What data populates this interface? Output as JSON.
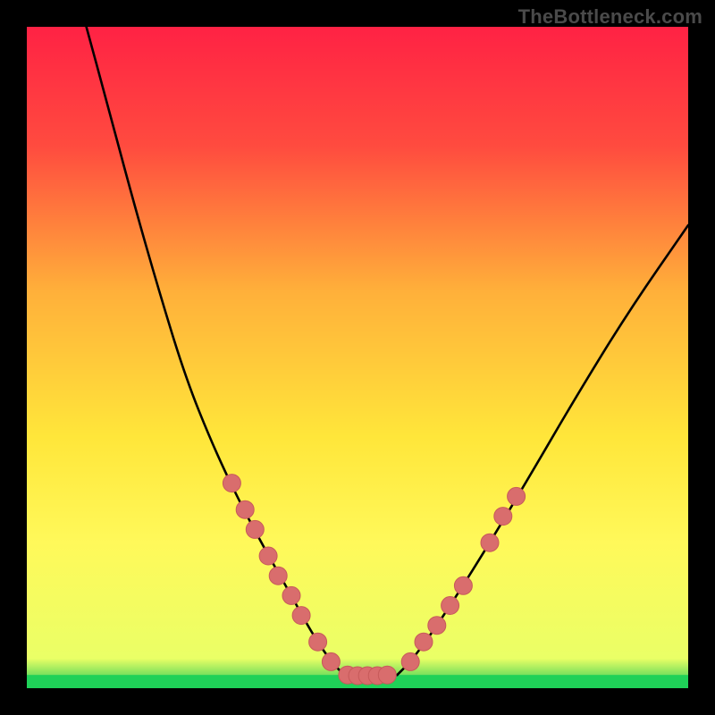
{
  "watermark": "TheBottleneck.com",
  "chart_data": {
    "type": "line",
    "title": "",
    "xlabel": "",
    "ylabel": "",
    "xlim": [
      0,
      100
    ],
    "ylim": [
      0,
      100
    ],
    "gradient_stops": [
      {
        "offset": 0,
        "color": "#ff2244"
      },
      {
        "offset": 0.18,
        "color": "#ff4b3f"
      },
      {
        "offset": 0.4,
        "color": "#ffb03a"
      },
      {
        "offset": 0.62,
        "color": "#ffe63a"
      },
      {
        "offset": 0.78,
        "color": "#fff95a"
      },
      {
        "offset": 0.955,
        "color": "#eaff66"
      },
      {
        "offset": 0.975,
        "color": "#8fe65e"
      },
      {
        "offset": 1.0,
        "color": "#1fd158"
      }
    ],
    "base_strip_y": 98,
    "series": [
      {
        "name": "left-branch",
        "curve": [
          {
            "x": 9.0,
            "y": 100.0
          },
          {
            "x": 12.0,
            "y": 89.0
          },
          {
            "x": 16.0,
            "y": 74.0
          },
          {
            "x": 20.0,
            "y": 60.0
          },
          {
            "x": 24.0,
            "y": 47.0
          },
          {
            "x": 28.0,
            "y": 37.0
          },
          {
            "x": 32.0,
            "y": 28.5
          },
          {
            "x": 36.0,
            "y": 21.0
          },
          {
            "x": 40.0,
            "y": 14.0
          },
          {
            "x": 43.0,
            "y": 8.5
          },
          {
            "x": 46.0,
            "y": 4.0
          },
          {
            "x": 48.0,
            "y": 2.0
          }
        ],
        "markers": [
          {
            "x": 31.0,
            "y": 31.0
          },
          {
            "x": 33.0,
            "y": 27.0
          },
          {
            "x": 34.5,
            "y": 24.0
          },
          {
            "x": 36.5,
            "y": 20.0
          },
          {
            "x": 38.0,
            "y": 17.0
          },
          {
            "x": 40.0,
            "y": 14.0
          },
          {
            "x": 41.5,
            "y": 11.0
          },
          {
            "x": 44.0,
            "y": 7.0
          },
          {
            "x": 46.0,
            "y": 4.0
          }
        ]
      },
      {
        "name": "right-branch",
        "curve": [
          {
            "x": 56.0,
            "y": 2.0
          },
          {
            "x": 58.0,
            "y": 4.0
          },
          {
            "x": 61.0,
            "y": 8.0
          },
          {
            "x": 65.0,
            "y": 14.0
          },
          {
            "x": 70.0,
            "y": 22.0
          },
          {
            "x": 76.0,
            "y": 32.0
          },
          {
            "x": 83.0,
            "y": 44.0
          },
          {
            "x": 91.0,
            "y": 57.0
          },
          {
            "x": 100.0,
            "y": 70.0
          }
        ],
        "markers": [
          {
            "x": 58.0,
            "y": 4.0
          },
          {
            "x": 60.0,
            "y": 7.0
          },
          {
            "x": 62.0,
            "y": 9.5
          },
          {
            "x": 64.0,
            "y": 12.5
          },
          {
            "x": 66.0,
            "y": 15.5
          },
          {
            "x": 70.0,
            "y": 22.0
          },
          {
            "x": 72.0,
            "y": 26.0
          },
          {
            "x": 74.0,
            "y": 29.0
          }
        ]
      },
      {
        "name": "trough",
        "curve": [
          {
            "x": 48.0,
            "y": 2.0
          },
          {
            "x": 50.0,
            "y": 1.8
          },
          {
            "x": 52.0,
            "y": 1.8
          },
          {
            "x": 54.0,
            "y": 1.9
          },
          {
            "x": 56.0,
            "y": 2.0
          }
        ],
        "markers": [
          {
            "x": 48.5,
            "y": 2.0
          },
          {
            "x": 50.0,
            "y": 1.9
          },
          {
            "x": 51.5,
            "y": 1.9
          },
          {
            "x": 53.0,
            "y": 1.9
          },
          {
            "x": 54.5,
            "y": 2.0
          }
        ]
      }
    ],
    "marker_style": {
      "radius": 10,
      "fill": "#d96d6d",
      "stroke": "#c75a5a"
    },
    "curve_style": {
      "stroke": "#000000",
      "width": 2.6
    }
  }
}
